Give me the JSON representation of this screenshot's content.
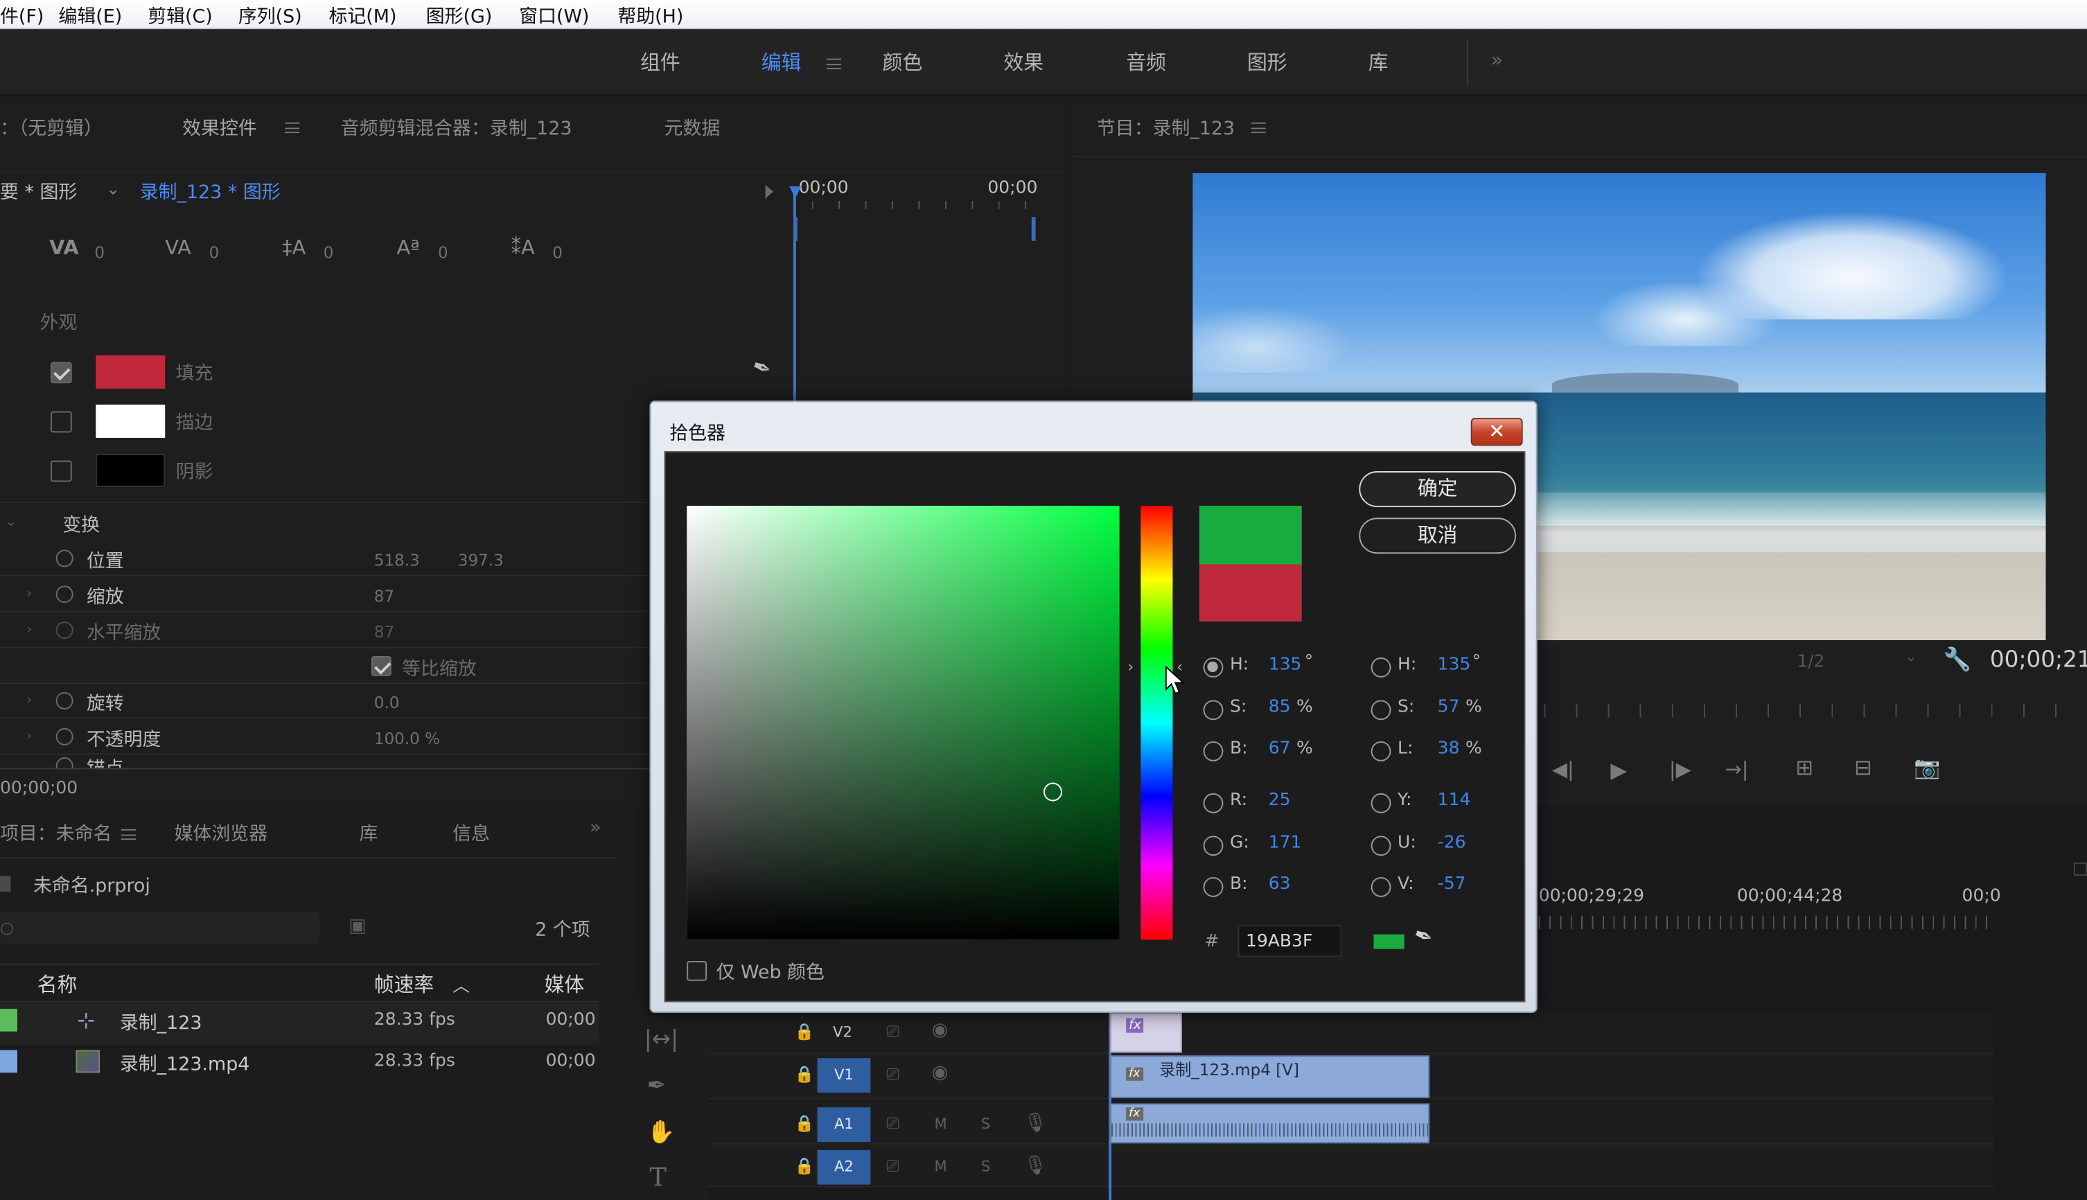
{
  "menubar": {
    "items": [
      "件(F)",
      "编辑(E)",
      "剪辑(C)",
      "序列(S)",
      "标记(M)",
      "图形(G)",
      "窗口(W)",
      "帮助(H)"
    ]
  },
  "workspaces": {
    "tabs": [
      "组件",
      "编辑",
      "颜色",
      "效果",
      "音频",
      "图形",
      "库"
    ],
    "active": "编辑",
    "more": "»"
  },
  "source_panel": {
    "tabs": [
      "：（无剪辑）",
      "效果控件",
      "音频剪辑混合器：录制_123",
      "元数据"
    ],
    "clip_path_prefix": "要 * 图形",
    "clip_path_active": "录制_123 * 图形",
    "timecode_left": "00;00",
    "timecode_right": "00;00",
    "text_props": [
      {
        "icon": "tracking-icon",
        "glyph": "VA",
        "value": "0"
      },
      {
        "icon": "kerning-icon",
        "glyph": "VA",
        "value": "0"
      },
      {
        "icon": "leading-icon",
        "glyph": "‡A",
        "value": "0"
      },
      {
        "icon": "baseline-shift-icon",
        "glyph": "Aª",
        "value": "0"
      },
      {
        "icon": "tsume-icon",
        "glyph": "⁑A",
        "value": "0"
      }
    ],
    "appearance_title": "外观",
    "appearance": [
      {
        "label": "填充",
        "color": "#c0283b",
        "checked": true
      },
      {
        "label": "描边",
        "color": "#ffffff",
        "checked": false
      },
      {
        "label": "阴影",
        "color": "#000000",
        "checked": false
      }
    ],
    "transform_title": "变换",
    "transform": [
      {
        "label": "位置",
        "v1": "518.3",
        "v2": "397.3"
      },
      {
        "label": "缩放",
        "v1": "87",
        "v2": ""
      },
      {
        "label": "水平缩放",
        "v1": "87",
        "v2": ""
      },
      {
        "label": "旋转",
        "v1": "0.0",
        "v2": ""
      },
      {
        "label": "不透明度",
        "v1": "100.0 %",
        "v2": ""
      },
      {
        "label": "锚点",
        "v1": "",
        "v2": ""
      }
    ],
    "uniform_scale": "等比缩放",
    "bottom_timecode": "00;00;00"
  },
  "program_panel": {
    "title": "节目：录制_123",
    "zoom": "1/2",
    "timecode": "00;00;21"
  },
  "project_panel": {
    "tabs": [
      "项目：未命名",
      "媒体浏览器",
      "库",
      "信息"
    ],
    "file": "未命名.prproj",
    "count": "2 个项",
    "columns": [
      "名称",
      "帧速率",
      "媒体"
    ],
    "rows": [
      {
        "name": "录制_123",
        "fps": "28.33 fps",
        "media": "00;00",
        "color": "#5bbd5b"
      },
      {
        "name": "录制_123.mp4",
        "fps": "28.33 fps",
        "media": "00;00",
        "color": "#7ea7e0"
      }
    ]
  },
  "timeline": {
    "ruler": [
      "00;00;29;29",
      "00;00;44;28",
      "00;0"
    ],
    "tracks": [
      "V2",
      "V1",
      "A1",
      "A2"
    ],
    "track_letters": {
      "mute": "M",
      "solo": "S"
    },
    "clip_name": "录制_123.mp4 [V]",
    "fx": "fx"
  },
  "color_picker": {
    "title": "拾色器",
    "close": "✕",
    "ok": "确定",
    "cancel": "取消",
    "new_color": "#19ab3f",
    "old_color": "#c0283b",
    "hue_color": "#00ff40",
    "web_only": "仅 Web 颜色",
    "hash": "#",
    "hex": "19AB3F",
    "left_fields": [
      {
        "label": "H:",
        "value": "135",
        "unit": "°",
        "selected": true
      },
      {
        "label": "S:",
        "value": "85",
        "unit": "%",
        "selected": false
      },
      {
        "label": "B:",
        "value": "67",
        "unit": "%",
        "selected": false
      },
      {
        "label": "R:",
        "value": "25",
        "unit": "",
        "selected": false
      },
      {
        "label": "G:",
        "value": "171",
        "unit": "",
        "selected": false
      },
      {
        "label": "B:",
        "value": "63",
        "unit": "",
        "selected": false
      }
    ],
    "right_fields": [
      {
        "label": "H:",
        "value": "135",
        "unit": "°"
      },
      {
        "label": "S:",
        "value": "57",
        "unit": "%"
      },
      {
        "label": "L:",
        "value": "38",
        "unit": "%"
      },
      {
        "label": "Y:",
        "value": "114",
        "unit": ""
      },
      {
        "label": "U:",
        "value": "-26",
        "unit": ""
      },
      {
        "label": "V:",
        "value": "-57",
        "unit": ""
      }
    ]
  }
}
